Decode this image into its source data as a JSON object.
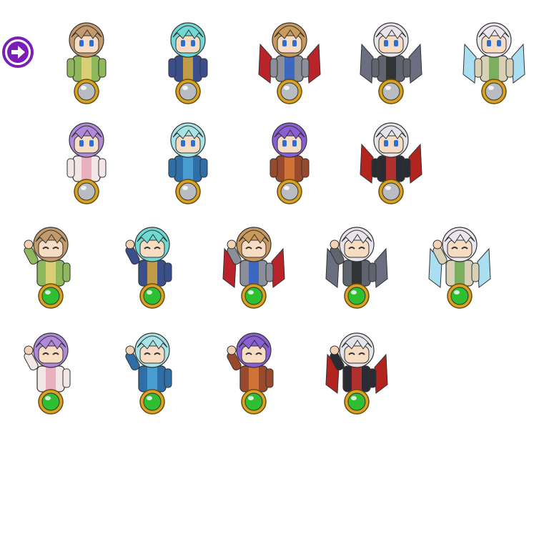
{
  "nav": {
    "icon": "arrow-right-circle-icon",
    "color": "#7a1fb5"
  },
  "orb_colors": {
    "idle": "#b9bcc1",
    "active": "#2fbf32",
    "ring": "#d7a320"
  },
  "rows": [
    {
      "pose": "front",
      "orb": "idle",
      "characters": [
        {
          "id": "blonde-girl",
          "hair": "#c49a6c",
          "outfit": "#8fb85c",
          "accent": "#e8d27a",
          "wings": ""
        },
        {
          "id": "cyan-knight",
          "hair": "#6fd9d4",
          "outfit": "#3b4f8c",
          "accent": "#d9a93a",
          "wings": ""
        },
        {
          "id": "headband-warrior",
          "hair": "#c99a5b",
          "outfit": "#8a8f99",
          "accent": "#2f62c9",
          "wings": "#b8242a"
        },
        {
          "id": "horned-demon",
          "hair": "#e8e4ea",
          "outfit": "#5f646e",
          "accent": "#2a2a2a",
          "wings": "#6a6e80"
        },
        {
          "id": "white-sage",
          "hair": "#ece6ef",
          "outfit": "#d9d1b6",
          "accent": "#6aa84f",
          "wings": "#a9dff0"
        }
      ]
    },
    {
      "pose": "front",
      "orb": "idle",
      "characters": [
        {
          "id": "lilac-girl",
          "hair": "#b08ad8",
          "outfit": "#f2e6e6",
          "accent": "#e9a6b8",
          "wings": ""
        },
        {
          "id": "aqua-mage",
          "hair": "#a8e4e6",
          "outfit": "#2f6fa8",
          "accent": "#4fa6d9",
          "wings": ""
        },
        {
          "id": "violet-fighter",
          "hair": "#8a5fd6",
          "outfit": "#9a4a2c",
          "accent": "#d97a3a",
          "wings": ""
        },
        {
          "id": "silver-vampire",
          "hair": "#e4e4ea",
          "outfit": "#2b2b33",
          "accent": "#c9302c",
          "wings": "#b3241f"
        }
      ]
    },
    {
      "pose": "cheer",
      "orb": "active",
      "characters": [
        {
          "id": "blonde-girl",
          "hair": "#c49a6c",
          "outfit": "#8fb85c",
          "accent": "#e8d27a",
          "wings": ""
        },
        {
          "id": "cyan-knight",
          "hair": "#6fd9d4",
          "outfit": "#3b4f8c",
          "accent": "#d9a93a",
          "wings": ""
        },
        {
          "id": "headband-warrior",
          "hair": "#c99a5b",
          "outfit": "#8a8f99",
          "accent": "#2f62c9",
          "wings": "#b8242a"
        },
        {
          "id": "horned-demon",
          "hair": "#e8e4ea",
          "outfit": "#5f646e",
          "accent": "#2a2a2a",
          "wings": "#6a6e80"
        },
        {
          "id": "white-sage",
          "hair": "#ece6ef",
          "outfit": "#d9d1b6",
          "accent": "#6aa84f",
          "wings": "#a9dff0"
        }
      ]
    },
    {
      "pose": "cheer",
      "orb": "active",
      "characters": [
        {
          "id": "lilac-girl",
          "hair": "#b08ad8",
          "outfit": "#f2e6e6",
          "accent": "#e9a6b8",
          "wings": ""
        },
        {
          "id": "aqua-mage",
          "hair": "#a8e4e6",
          "outfit": "#2f6fa8",
          "accent": "#4fa6d9",
          "wings": ""
        },
        {
          "id": "violet-fighter",
          "hair": "#8a5fd6",
          "outfit": "#9a4a2c",
          "accent": "#d97a3a",
          "wings": ""
        },
        {
          "id": "silver-vampire",
          "hair": "#e4e4ea",
          "outfit": "#2b2b33",
          "accent": "#c9302c",
          "wings": "#b3241f"
        }
      ]
    }
  ]
}
